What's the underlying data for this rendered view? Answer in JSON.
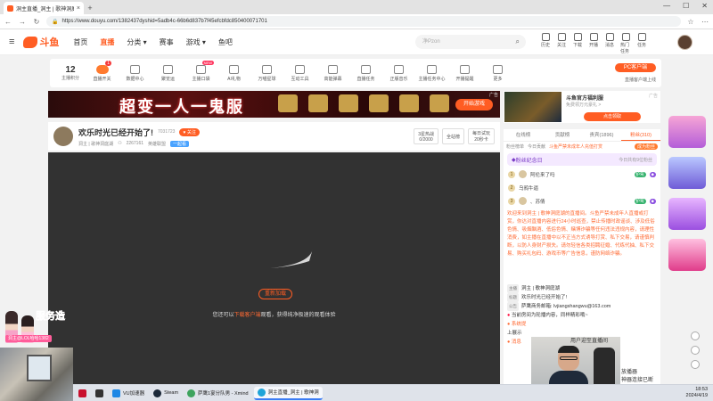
{
  "browser": {
    "tab_title": "洞主直播_洞主 | 歌神洞庭湖直播...",
    "url": "https://www.douyu.com/1382437dyshid=5adb4c-66b6d837b7f45efcbfdc850400071701"
  },
  "header": {
    "logo_text": "斗鱼",
    "nav": [
      "首页",
      "直播",
      "分类",
      "赛事",
      "游戏",
      "鱼吧"
    ],
    "search_placeholder": "净Pzon",
    "icons": [
      "历史",
      "关注",
      "下载",
      "开播",
      "消息",
      "热门任务",
      "任务"
    ]
  },
  "toolbar": {
    "score": "12",
    "score_label": "主播积分",
    "items": [
      "直播开关",
      "数据中心",
      "聚览运",
      "主播口袋",
      "AI礼物",
      "万喵星球",
      "互动工具",
      "高能弹幕",
      "直播任务",
      "正版音乐",
      "主播任务中心",
      "开播提醒",
      "更多"
    ],
    "badge": "1",
    "new_label": "NEW",
    "pc_client": "PC客户端",
    "pc_sub": "直播客户端上线"
  },
  "banner": {
    "headline": "超变一人一鬼服",
    "button": "开始游戏",
    "ad": "广告"
  },
  "room": {
    "title": "欢乐时光已经开始了!",
    "room_id": "7031723",
    "follow": "关注",
    "anchor": "洞主 | 歌神洞庭湖",
    "viewers": "2267161",
    "category": "英雄联盟",
    "tag": "一起看",
    "btn1_top": "3星热战",
    "btn1_bottom": "0/2000",
    "btn2": "全站榜",
    "btn3_top": "每日试玩",
    "btn3_bottom": "20秒卡"
  },
  "player": {
    "reload": "重新加载",
    "tip_before": "您还可以",
    "tip_link": "下载客户端",
    "tip_after": "观看，获得纯净极速的观看体验"
  },
  "ad_card": {
    "title": "斗鱼官方福利服",
    "sub": "免费领万元豪礼 >",
    "button": "点击领取",
    "ad": "广告"
  },
  "chat": {
    "tabs": [
      "在线榜",
      "贡献榜",
      "贵宾(1896)",
      "粉丝(310)"
    ],
    "sub_left": "粉丝榜单",
    "sub_mid": "今日贡献",
    "sub_info": "斗鱼严禁未成年人充值打赏",
    "become": "成为粉丝",
    "fanclub": "粉丝纪念日",
    "fanclub_right": "今日共有9位粉丝",
    "ranks": [
      {
        "n": "1",
        "name": "阿伦来了吗",
        "lv": "护驾"
      },
      {
        "n": "2",
        "name": "乌鸦牛逼",
        "lv": ""
      },
      {
        "n": "3",
        "name": "、苏倩",
        "lv": "护驾"
      }
    ],
    "notice": "欢迎来到洞主 | 歌神洞庭湖的直播间。斗鱼严禁未成年人直播或打赏，你达对直播内容进行24小时巡查，禁止传播时政谣谈、涉及低俗色情、吸烟酗酒、低俗色情、赌博诈骗等任何违法违规内容，请理性消费，如主播在直播中以不正当方式诱导打赏、私下交易，请谨慎判断，以防人身财产损失。请勿轻信各类招聘征婚、代练代抽、私下交易、购买礼包码、游戏币等广告信息，谨防网络诈骗。",
    "meta": [
      {
        "lab": "主播",
        "text": "洞主 | 歌神洞庭湖"
      },
      {
        "lab": "标题",
        "text": "欢乐时光已经开始了!"
      },
      {
        "lab": "公告",
        "text": "萨鹰商务邮箱: lvjiangshangwu@163.com"
      }
    ],
    "sys1": "当前房间为轮播内容，同样精彩哦~",
    "sys2": "系统提",
    "sys2b": "上展示",
    "sys3": "",
    "sys3b": "消息"
  },
  "overlay": {
    "vt_title": "服务造",
    "vt_sub": "洞主@LOL哈哈1382",
    "text1": "用户迎至直播间",
    "text2a": "放播器",
    "text2b": "神器连接已断",
    "text2c": "开"
  },
  "taskbar": {
    "items": [
      "",
      "",
      "VU加速器",
      "Steam",
      "萨鹰1宴分队男 - Xmind",
      "洞主直播_洞主 | 歌神洞"
    ],
    "time": "18:53",
    "date": "2024/4/19"
  }
}
